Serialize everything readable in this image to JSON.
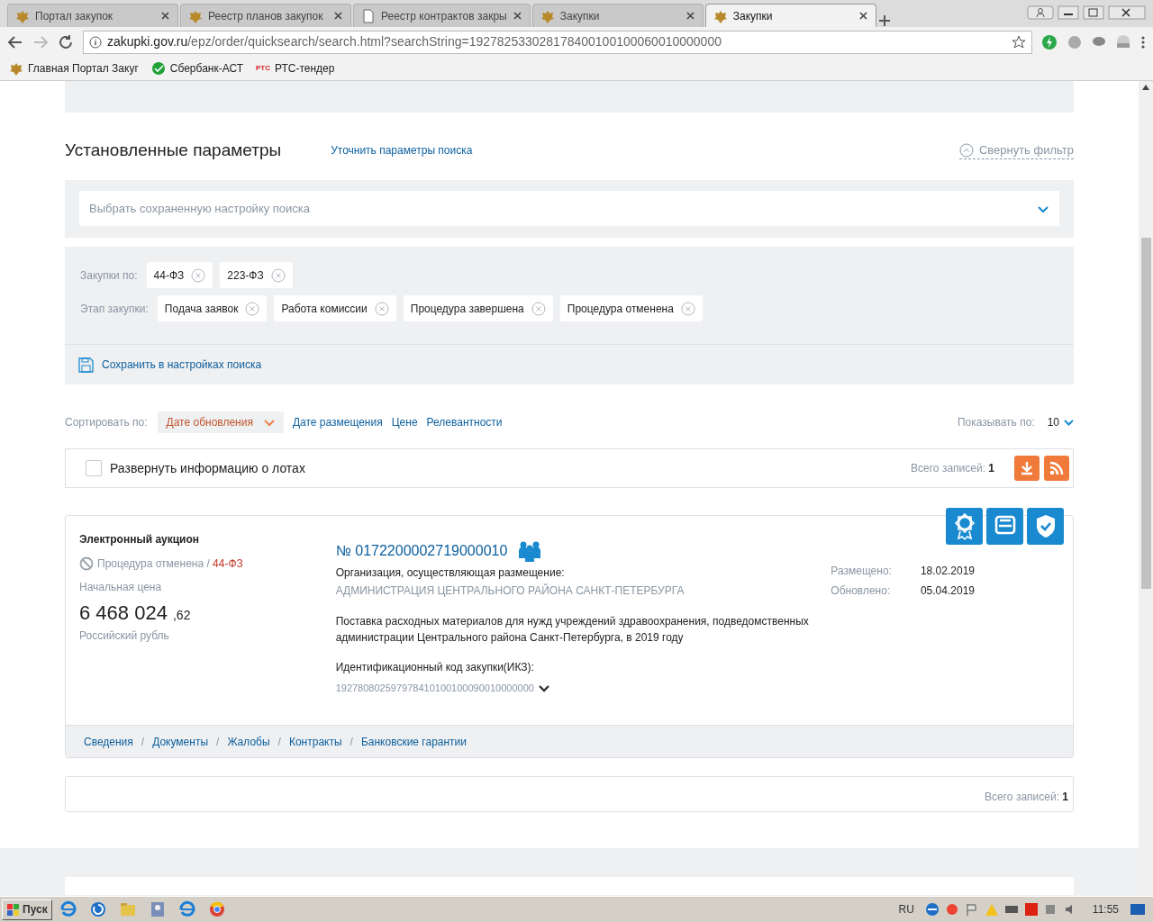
{
  "browser": {
    "tabs": [
      {
        "label": "Портал закупок",
        "kind": "crest",
        "selected": false
      },
      {
        "label": "Реестр планов закупок",
        "kind": "crest",
        "selected": false
      },
      {
        "label": "Реестр контрактов закры",
        "kind": "page",
        "selected": false
      },
      {
        "label": "Закупки",
        "kind": "crest",
        "selected": false
      },
      {
        "label": "Закупки",
        "kind": "crest",
        "selected": true
      }
    ],
    "address_host": "zakupki.gov.ru",
    "address_path": "/epz/order/quicksearch/search.html?searchString=192782533028178400100100060010000000",
    "bookmarks": [
      {
        "label": "Главная Портал Закуг",
        "kind": "crest"
      },
      {
        "label": "Сбербанк-АСТ",
        "kind": "sber"
      },
      {
        "label": "РТС-тендер",
        "kind": "rts",
        "logo_text": "РТС"
      }
    ]
  },
  "filter": {
    "title": "Установленные параметры",
    "refine_link": "Уточнить параметры поиска",
    "collapse_link": "Свернуть фильтр",
    "saved_select_placeholder": "Выбрать сохраненную настройку поиска",
    "groups": [
      {
        "label": "Закупки по:",
        "chips": [
          "44-ФЗ",
          "223-ФЗ"
        ]
      },
      {
        "label": "Этап закупки:",
        "chips": [
          "Подача заявок",
          "Работа комиссии",
          "Процедура завершена",
          "Процедура отменена"
        ]
      }
    ],
    "save_link": "Сохранить в настройках поиска"
  },
  "sort": {
    "label": "Сортировать по:",
    "options": [
      {
        "label": "Дате обновления",
        "selected": true
      },
      {
        "label": "Дате размещения",
        "selected": false
      },
      {
        "label": "Цене",
        "selected": false
      },
      {
        "label": "Релевантности",
        "selected": false
      }
    ],
    "page_size_label": "Показывать по:",
    "page_size": "10"
  },
  "results_bar": {
    "expand_label": "Развернуть информацию о лотах",
    "expand_checked": false,
    "total_label": "Всего записей:",
    "total": "1"
  },
  "result": {
    "type": "Электронный аукцион",
    "status": "Процедура отменена",
    "status_separator": "/",
    "law": "44-ФЗ",
    "price_label": "Начальная цена",
    "price_main": "6 468 024",
    "price_fraction": ",62",
    "currency": "Российский рубль",
    "number": "№ 0172200002719000010",
    "org_label": "Организация, осуществляющая размещение:",
    "org_name": "АДМИНИСТРАЦИЯ ЦЕНТРАЛЬНОГО РАЙОНА САНКТ-ПЕТЕРБУРГА",
    "description": "Поставка расходных материалов для нужд учреждений здравоохранения, подведомственных администрации Центрального района Санкт-Петербурга, в 2019 году",
    "ikz_label": "Идентификационный код закупки(ИКЗ):",
    "ikz": "192780802597978410100100090010000000",
    "dates": [
      {
        "label": "Размещено:",
        "value": "18.02.2019"
      },
      {
        "label": "Обновлено:",
        "value": "05.04.2019"
      }
    ],
    "link_separator": "/",
    "links": [
      "Сведения",
      "Документы",
      "Жалобы",
      "Контракты",
      "Банковские гарантии"
    ]
  },
  "footer_total": {
    "label": "Всего записей:",
    "value": "1"
  },
  "taskbar": {
    "start": "Пуск",
    "lang": "RU",
    "time": "11:55"
  }
}
